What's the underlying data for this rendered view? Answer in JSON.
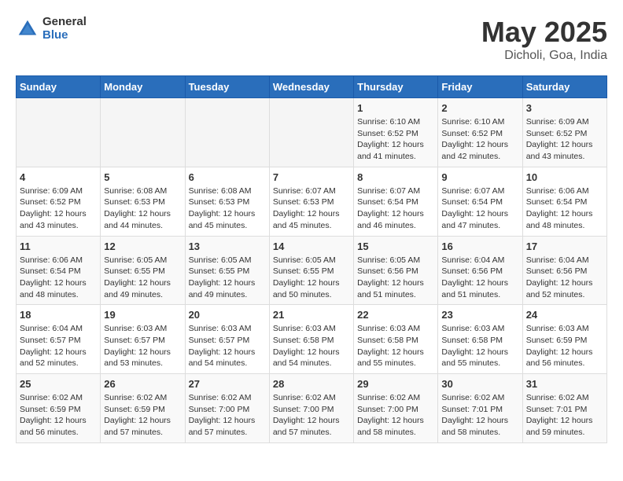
{
  "logo": {
    "general": "General",
    "blue": "Blue"
  },
  "title": {
    "month_year": "May 2025",
    "location": "Dicholi, Goa, India"
  },
  "weekdays": [
    "Sunday",
    "Monday",
    "Tuesday",
    "Wednesday",
    "Thursday",
    "Friday",
    "Saturday"
  ],
  "weeks": [
    [
      {
        "day": "",
        "info": ""
      },
      {
        "day": "",
        "info": ""
      },
      {
        "day": "",
        "info": ""
      },
      {
        "day": "",
        "info": ""
      },
      {
        "day": "1",
        "info": "Sunrise: 6:10 AM\nSunset: 6:52 PM\nDaylight: 12 hours\nand 41 minutes."
      },
      {
        "day": "2",
        "info": "Sunrise: 6:10 AM\nSunset: 6:52 PM\nDaylight: 12 hours\nand 42 minutes."
      },
      {
        "day": "3",
        "info": "Sunrise: 6:09 AM\nSunset: 6:52 PM\nDaylight: 12 hours\nand 43 minutes."
      }
    ],
    [
      {
        "day": "4",
        "info": "Sunrise: 6:09 AM\nSunset: 6:52 PM\nDaylight: 12 hours\nand 43 minutes."
      },
      {
        "day": "5",
        "info": "Sunrise: 6:08 AM\nSunset: 6:53 PM\nDaylight: 12 hours\nand 44 minutes."
      },
      {
        "day": "6",
        "info": "Sunrise: 6:08 AM\nSunset: 6:53 PM\nDaylight: 12 hours\nand 45 minutes."
      },
      {
        "day": "7",
        "info": "Sunrise: 6:07 AM\nSunset: 6:53 PM\nDaylight: 12 hours\nand 45 minutes."
      },
      {
        "day": "8",
        "info": "Sunrise: 6:07 AM\nSunset: 6:54 PM\nDaylight: 12 hours\nand 46 minutes."
      },
      {
        "day": "9",
        "info": "Sunrise: 6:07 AM\nSunset: 6:54 PM\nDaylight: 12 hours\nand 47 minutes."
      },
      {
        "day": "10",
        "info": "Sunrise: 6:06 AM\nSunset: 6:54 PM\nDaylight: 12 hours\nand 48 minutes."
      }
    ],
    [
      {
        "day": "11",
        "info": "Sunrise: 6:06 AM\nSunset: 6:54 PM\nDaylight: 12 hours\nand 48 minutes."
      },
      {
        "day": "12",
        "info": "Sunrise: 6:05 AM\nSunset: 6:55 PM\nDaylight: 12 hours\nand 49 minutes."
      },
      {
        "day": "13",
        "info": "Sunrise: 6:05 AM\nSunset: 6:55 PM\nDaylight: 12 hours\nand 49 minutes."
      },
      {
        "day": "14",
        "info": "Sunrise: 6:05 AM\nSunset: 6:55 PM\nDaylight: 12 hours\nand 50 minutes."
      },
      {
        "day": "15",
        "info": "Sunrise: 6:05 AM\nSunset: 6:56 PM\nDaylight: 12 hours\nand 51 minutes."
      },
      {
        "day": "16",
        "info": "Sunrise: 6:04 AM\nSunset: 6:56 PM\nDaylight: 12 hours\nand 51 minutes."
      },
      {
        "day": "17",
        "info": "Sunrise: 6:04 AM\nSunset: 6:56 PM\nDaylight: 12 hours\nand 52 minutes."
      }
    ],
    [
      {
        "day": "18",
        "info": "Sunrise: 6:04 AM\nSunset: 6:57 PM\nDaylight: 12 hours\nand 52 minutes."
      },
      {
        "day": "19",
        "info": "Sunrise: 6:03 AM\nSunset: 6:57 PM\nDaylight: 12 hours\nand 53 minutes."
      },
      {
        "day": "20",
        "info": "Sunrise: 6:03 AM\nSunset: 6:57 PM\nDaylight: 12 hours\nand 54 minutes."
      },
      {
        "day": "21",
        "info": "Sunrise: 6:03 AM\nSunset: 6:58 PM\nDaylight: 12 hours\nand 54 minutes."
      },
      {
        "day": "22",
        "info": "Sunrise: 6:03 AM\nSunset: 6:58 PM\nDaylight: 12 hours\nand 55 minutes."
      },
      {
        "day": "23",
        "info": "Sunrise: 6:03 AM\nSunset: 6:58 PM\nDaylight: 12 hours\nand 55 minutes."
      },
      {
        "day": "24",
        "info": "Sunrise: 6:03 AM\nSunset: 6:59 PM\nDaylight: 12 hours\nand 56 minutes."
      }
    ],
    [
      {
        "day": "25",
        "info": "Sunrise: 6:02 AM\nSunset: 6:59 PM\nDaylight: 12 hours\nand 56 minutes."
      },
      {
        "day": "26",
        "info": "Sunrise: 6:02 AM\nSunset: 6:59 PM\nDaylight: 12 hours\nand 57 minutes."
      },
      {
        "day": "27",
        "info": "Sunrise: 6:02 AM\nSunset: 7:00 PM\nDaylight: 12 hours\nand 57 minutes."
      },
      {
        "day": "28",
        "info": "Sunrise: 6:02 AM\nSunset: 7:00 PM\nDaylight: 12 hours\nand 57 minutes."
      },
      {
        "day": "29",
        "info": "Sunrise: 6:02 AM\nSunset: 7:00 PM\nDaylight: 12 hours\nand 58 minutes."
      },
      {
        "day": "30",
        "info": "Sunrise: 6:02 AM\nSunset: 7:01 PM\nDaylight: 12 hours\nand 58 minutes."
      },
      {
        "day": "31",
        "info": "Sunrise: 6:02 AM\nSunset: 7:01 PM\nDaylight: 12 hours\nand 59 minutes."
      }
    ]
  ]
}
